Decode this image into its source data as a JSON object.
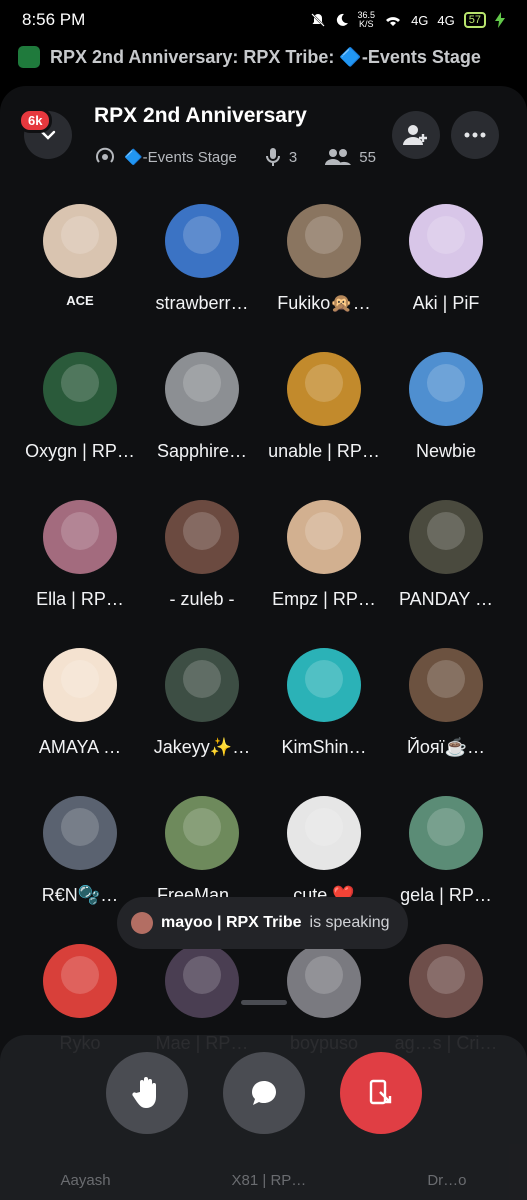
{
  "status_bar": {
    "time": "8:56 PM",
    "net_speed_value": "36.5",
    "net_speed_unit": "K/S",
    "signal_1": "4G",
    "signal_2": "4G",
    "battery": "57"
  },
  "activity_bar": {
    "text": "RPX 2nd Anniversary: RPX Tribe: 🔷-Events Stage"
  },
  "header": {
    "title": "RPX 2nd Anniversary",
    "unread_badge": "6k",
    "stage_name": "🔷-Events Stage",
    "speakers_count": "3",
    "listeners_count": "55"
  },
  "participants": [
    {
      "name": "ACE",
      "color": "#d9c4b0"
    },
    {
      "name": "strawberr…",
      "color": "#3b73c4"
    },
    {
      "name": "Fukiko🙊…",
      "color": "#8a7560"
    },
    {
      "name": "Aki | PiF",
      "color": "#d8c6e8"
    },
    {
      "name": "Oxygn | RP…",
      "color": "#2a5a3a"
    },
    {
      "name": "Sapphire…",
      "color": "#8c8f93"
    },
    {
      "name": "unable | RP…",
      "color": "#c28a2c"
    },
    {
      "name": "Newbie",
      "color": "#4f8fd0"
    },
    {
      "name": "Ella | RP…",
      "color": "#a36b7e"
    },
    {
      "name": "- zuleb -",
      "color": "#6b4a40"
    },
    {
      "name": "Empz | RP…",
      "color": "#d2b090"
    },
    {
      "name": "PANDAY …",
      "color": "#4a4a3e"
    },
    {
      "name": "AMAYA …",
      "color": "#f4e2d0"
    },
    {
      "name": "Jakeyy✨…",
      "color": "#3d4e44"
    },
    {
      "name": "KimShin…",
      "color": "#2bb2b7"
    },
    {
      "name": "Йояї☕…",
      "color": "#6c5240"
    },
    {
      "name": "R€N🫧…",
      "color": "#5a6270"
    },
    {
      "name": "FreeMan…",
      "color": "#6e8a5c"
    },
    {
      "name": "cute ❤️",
      "color": "#e6e6e6"
    },
    {
      "name": "gela | RP…",
      "color": "#5b8c76"
    },
    {
      "name": "Ryko",
      "color": "#d8403a"
    },
    {
      "name": "Mae | RP…",
      "color": "#4a3e52"
    },
    {
      "name": "boypuso",
      "color": "#7a7a80"
    },
    {
      "name": "ag…s | Cri…",
      "color": "#6e4e4a"
    }
  ],
  "speaking_toast": {
    "name": "mayoo | RPX Tribe",
    "suffix": "is speaking"
  },
  "controls": {
    "raise_hand_icon": "hand-icon",
    "chat_icon": "chat-bubble-icon",
    "leave_icon": "leave-call-icon"
  },
  "peek_row": [
    "Aayash",
    "X81 | RP…",
    "Dr…o"
  ]
}
